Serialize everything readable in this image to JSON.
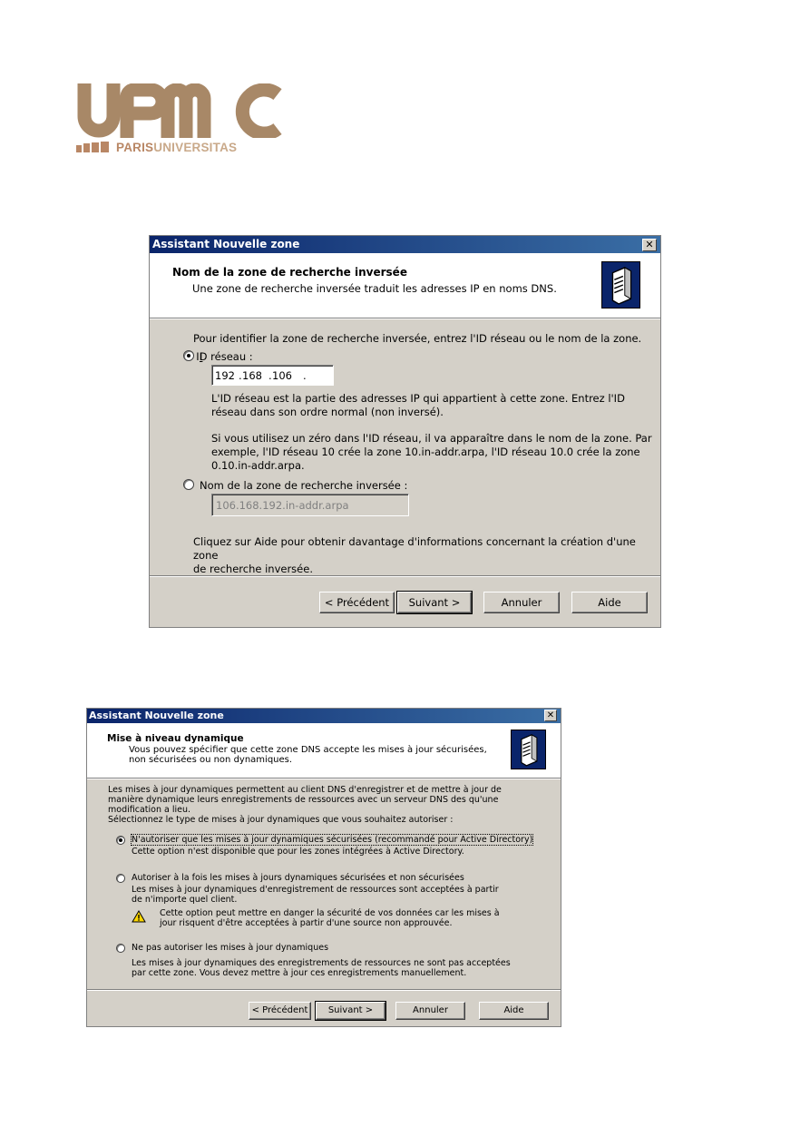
{
  "logo": {
    "wordmark": "UPMC",
    "paris": "PARIS",
    "universitas": "UNIVERSITAS"
  },
  "colors": {
    "logo_brown": "#a88867",
    "titlebar_start": "#0a246a",
    "titlebar_end": "#3a6ea5",
    "dialog_face": "#d4d0c8"
  },
  "dialog1": {
    "title": "Assistant Nouvelle zone",
    "close_glyph": "✕",
    "header_title": "Nom de la zone de recherche inversée",
    "header_subtitle": "Une zone de recherche inversée traduit les adresses IP en noms DNS.",
    "header_icon": "server-icon",
    "intro": "Pour identifier la zone de recherche inversée, entrez l'ID réseau ou le nom de la zone.",
    "option_network_id": {
      "label": "ID réseau :",
      "selected": true
    },
    "ip_octets": [
      "192",
      "168",
      "106",
      ""
    ],
    "desc1": "L'ID réseau est la partie des adresses IP qui appartient à cette zone. Entrez l'ID\nréseau dans son ordre normal (non inversé).",
    "desc2": "Si vous utilisez un zéro dans l'ID réseau, il va apparaître dans le nom de la zone. Par\nexemple, l'ID réseau 10 crée la zone 10.in-addr.arpa, l'ID réseau 10.0 crée la zone\n0.10.in-addr.arpa.",
    "option_zone_name": {
      "label": "Nom de la zone de recherche inversée :",
      "selected": false
    },
    "zone_name_value": "106.168.192.in-addr.arpa",
    "help_text": "Cliquez sur Aide pour obtenir davantage d'informations concernant la création d'une zone\nde recherche inversée.",
    "buttons": {
      "back": "< Précédent",
      "next": "Suivant >",
      "cancel": "Annuler",
      "help": "Aide"
    }
  },
  "dialog2": {
    "title": "Assistant Nouvelle zone",
    "close_glyph": "✕",
    "header_title": "Mise à niveau dynamique",
    "header_subtitle": "Vous pouvez spécifier que cette zone DNS accepte les mises à jour sécurisées,\nnon sécurisées ou non dynamiques.",
    "header_icon": "server-icon",
    "intro": "Les mises à jour dynamiques permettent au client DNS d'enregistrer et de mettre à jour de\nmanière dynamique leurs enregistrements de ressources avec un serveur DNS des qu'une\nmodification a lieu.\nSélectionnez le type de mises à jour dynamiques que vous souhaitez autoriser :",
    "option_secure": {
      "label": "N'autoriser que les mises à jour dynamiques sécurisées (recommandé pour Active Directory)",
      "desc": "Cette option n'est disponible que pour les zones intégrées à Active Directory.",
      "selected": true
    },
    "option_both": {
      "label": "Autoriser à la fois les mises à jours dynamiques sécurisées et non sécurisées",
      "desc": "Les mises à jour dynamiques d'enregistrement de ressources sont acceptées à partir\nde n'importe quel client.",
      "warning": "Cette option peut mettre en danger la sécurité de vos données car les mises à\njour risquent d'être acceptées à partir d'une source non approuvée.",
      "selected": false
    },
    "option_none": {
      "label": "Ne pas autoriser les mises à jour dynamiques",
      "desc": "Les mises à jour dynamiques des enregistrements de ressources ne sont pas acceptées\npar cette zone. Vous devez mettre à jour ces enregistrements manuellement.",
      "selected": false
    },
    "buttons": {
      "back": "< Précédent",
      "next": "Suivant >",
      "cancel": "Annuler",
      "help": "Aide"
    }
  }
}
